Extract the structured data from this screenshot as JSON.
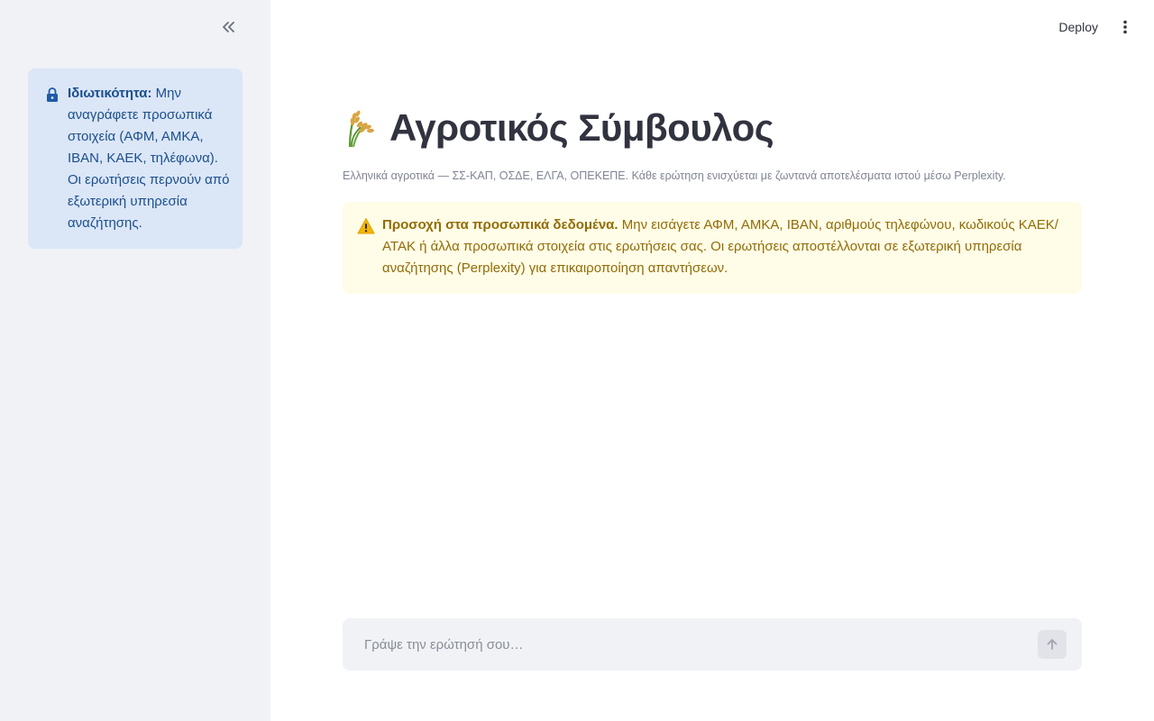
{
  "sidebar": {
    "collapse_icon": "double-chevron-left-icon",
    "privacy": {
      "icon": "lock-icon",
      "label": "Ιδιωτικότητα:",
      "text": " Μην αναγράφετε προσωπικά στοιχεία (ΑΦΜ, ΑΜΚΑ, IBAN, ΚΑΕΚ, τηλέφωνα). Οι ερωτήσεις περνούν από εξωτερική υπηρεσία αναζήτησης."
    }
  },
  "header": {
    "deploy_label": "Deploy",
    "menu_icon": "vertical-dots-icon"
  },
  "main": {
    "title_icon": "rice-sheaf-icon",
    "title": "Αγροτικός Σύμβουλος",
    "caption": "Ελληνικά αγροτικά — ΣΣ-ΚΑΠ, ΟΣΔΕ, ΕΛΓΑ, ΟΠΕΚΕΠΕ. Κάθε ερώτηση ενισχύεται με ζωντανά αποτελέσματα ιστού μέσω Perplexity.",
    "warning": {
      "icon": "warning-icon",
      "label": "Προσοχή στα προσωπικά δεδομένα.",
      "text": " Μην εισάγετε ΑΦΜ, ΑΜΚΑ, IBAN, αριθμούς τηλεφώνου, κωδικούς ΚΑΕΚ/ΑΤΑΚ ή άλλα προσωπικά στοιχεία στις ερωτήσεις σας. Οι ερωτήσεις αποστέλλονται σε εξωτερική υπηρεσία αναζήτησης (Perplexity) για επικαιροποίηση απαντήσεων."
    }
  },
  "chat": {
    "placeholder": "Γράψε την ερώτησή σου…",
    "value": "",
    "send_icon": "arrow-up-icon"
  },
  "colors": {
    "sidebar_bg": "#f0f2f6",
    "info_bg": "#dbe6f7",
    "info_text": "#1a4f8c",
    "warning_bg": "#fffce7",
    "warning_text": "#926c05",
    "title_text": "#31333f"
  }
}
